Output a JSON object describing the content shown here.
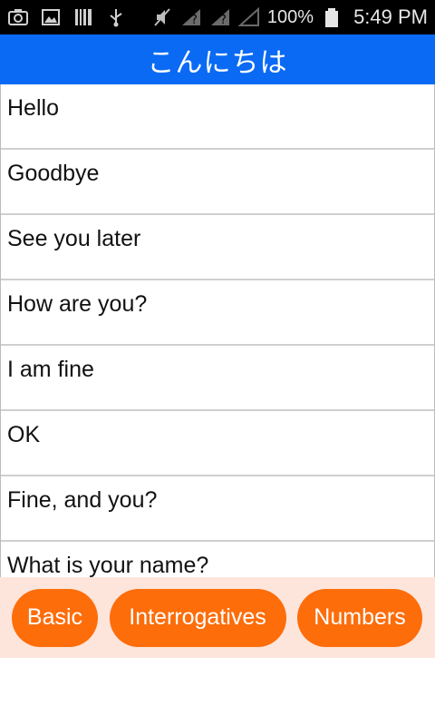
{
  "status_bar": {
    "left_icons": [
      "camera-icon",
      "image-icon",
      "barcode-icon",
      "usb-icon"
    ],
    "right_icons": [
      "mute-icon",
      "signal-unknown-icon",
      "signal-unknown-icon-2",
      "signal-empty-icon",
      "battery-icon"
    ],
    "battery": "100%",
    "time": "5:49 PM"
  },
  "header": {
    "title": "こんにちは",
    "color": "#0a6af4"
  },
  "phrases": [
    "Hello",
    "Goodbye",
    "See you later",
    "How are you?",
    "I am fine",
    "OK",
    "Fine, and you?",
    "What is your name?"
  ],
  "tabs": {
    "basic": "Basic",
    "interrogatives": "Interrogatives",
    "numbers": "Numbers",
    "color": "#fd6d0a",
    "bar_color": "#fde5db"
  }
}
